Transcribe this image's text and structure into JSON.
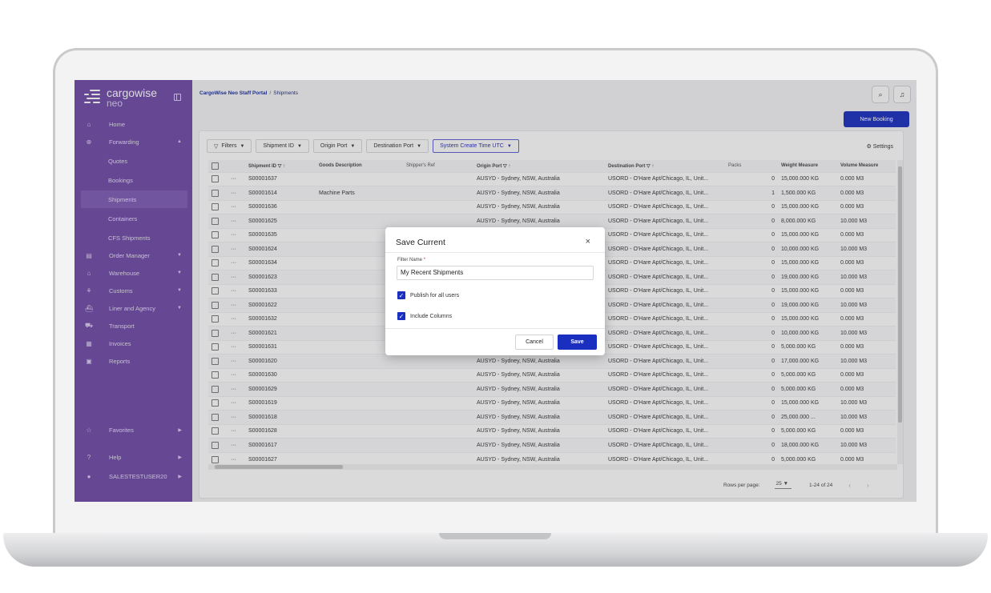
{
  "app": {
    "logo_line1": "cargowise",
    "logo_line2": "neo"
  },
  "breadcrumb": {
    "root": "CargoWise Neo Staff Portal",
    "separator": "/",
    "current": "Shipments"
  },
  "sidebar": {
    "items": [
      {
        "label": "Home",
        "icon": "home-icon",
        "icon_glyph": "⌂"
      },
      {
        "label": "Forwarding",
        "icon": "globe-icon",
        "icon_glyph": "⊕",
        "chevron": "▲"
      },
      {
        "label": "Quotes"
      },
      {
        "label": "Bookings"
      },
      {
        "label": "Shipments"
      },
      {
        "label": "Containers"
      },
      {
        "label": "CFS Shipments"
      },
      {
        "label": "Order Manager",
        "icon": "calendar-icon",
        "icon_glyph": "▤",
        "chevron": "▼"
      },
      {
        "label": "Warehouse",
        "icon": "warehouse-icon",
        "icon_glyph": "⌂",
        "chevron": "▼"
      },
      {
        "label": "Customs",
        "icon": "customs-icon",
        "icon_glyph": "⚘",
        "chevron": "▼"
      },
      {
        "label": "Liner and Agency",
        "icon": "ship-icon",
        "icon_glyph": "⛴",
        "chevron": "▼"
      },
      {
        "label": "Transport",
        "icon": "truck-icon",
        "icon_glyph": "⛟"
      },
      {
        "label": "Invoices",
        "icon": "invoice-icon",
        "icon_glyph": "▦"
      },
      {
        "label": "Reports",
        "icon": "reports-icon",
        "icon_glyph": "▣"
      }
    ],
    "bottom": [
      {
        "label": "Favorites",
        "icon": "star-icon",
        "icon_glyph": "☆",
        "chevron": "▶"
      },
      {
        "label": "Help",
        "icon": "help-icon",
        "icon_glyph": "?",
        "chevron": "▶"
      },
      {
        "label": "SALESTESTUSER20",
        "icon": "user-icon",
        "icon_glyph": "●",
        "chevron": "▶"
      }
    ]
  },
  "header": {
    "search_icon_glyph": "⌕",
    "bell_icon_glyph": "♫",
    "new_booking_label": "New Booking"
  },
  "filters": {
    "filters_label": "Filters",
    "chips": [
      "Shipment ID",
      "Origin Port",
      "Destination Port",
      "System Create Time UTC"
    ],
    "settings_label": "Settings"
  },
  "table": {
    "columns": [
      "Shipment ID",
      "Goods Description",
      "Shipper's Ref",
      "Origin Port",
      "Destination Port",
      "Packs",
      "Weight Measure",
      "Volume Measure"
    ],
    "row_marker": "···",
    "rows": [
      {
        "id": "S00001637",
        "goods": "",
        "ref": "",
        "origin": "AUSYD - Sydney, NSW, Australia",
        "dest": "USORD - O'Hare Apt/Chicago, IL, Unit...",
        "packs": "0",
        "weight": "15,000.000 KG",
        "volume": "0.000 M3"
      },
      {
        "id": "S00001614",
        "goods": "Machine Parts",
        "ref": "",
        "origin": "AUSYD - Sydney, NSW, Australia",
        "dest": "USORD - O'Hare Apt/Chicago, IL, Unit...",
        "packs": "1",
        "weight": "1,500.000 KG",
        "volume": "0.000 M3"
      },
      {
        "id": "S00001636",
        "goods": "",
        "ref": "",
        "origin": "AUSYD - Sydney, NSW, Australia",
        "dest": "USORD - O'Hare Apt/Chicago, IL, Unit...",
        "packs": "0",
        "weight": "15,000.000 KG",
        "volume": "0.000 M3"
      },
      {
        "id": "S00001625",
        "goods": "",
        "ref": "",
        "origin": "AUSYD - Sydney, NSW, Australia",
        "dest": "USORD - O'Hare Apt/Chicago, IL, Unit...",
        "packs": "0",
        "weight": "8,000.000 KG",
        "volume": "10.000 M3"
      },
      {
        "id": "S00001635",
        "goods": "",
        "ref": "",
        "origin": "",
        "dest": "USORD - O'Hare Apt/Chicago, IL, Unit...",
        "packs": "0",
        "weight": "15,000.000 KG",
        "volume": "0.000 M3"
      },
      {
        "id": "S00001624",
        "goods": "",
        "ref": "",
        "origin": "",
        "dest": "USORD - O'Hare Apt/Chicago, IL, Unit...",
        "packs": "0",
        "weight": "10,000.000 KG",
        "volume": "10.000 M3"
      },
      {
        "id": "S00001634",
        "goods": "",
        "ref": "",
        "origin": "",
        "dest": "USORD - O'Hare Apt/Chicago, IL, Unit...",
        "packs": "0",
        "weight": "15,000.000 KG",
        "volume": "0.000 M3"
      },
      {
        "id": "S00001623",
        "goods": "",
        "ref": "",
        "origin": "",
        "dest": "USORD - O'Hare Apt/Chicago, IL, Unit...",
        "packs": "0",
        "weight": "19,000.000 KG",
        "volume": "10.000 M3"
      },
      {
        "id": "S00001633",
        "goods": "",
        "ref": "",
        "origin": "",
        "dest": "USORD - O'Hare Apt/Chicago, IL, Unit...",
        "packs": "0",
        "weight": "15,000.000 KG",
        "volume": "0.000 M3"
      },
      {
        "id": "S00001622",
        "goods": "",
        "ref": "",
        "origin": "",
        "dest": "USORD - O'Hare Apt/Chicago, IL, Unit...",
        "packs": "0",
        "weight": "19,000.000 KG",
        "volume": "10.000 M3"
      },
      {
        "id": "S00001632",
        "goods": "",
        "ref": "",
        "origin": "",
        "dest": "USORD - O'Hare Apt/Chicago, IL, Unit...",
        "packs": "0",
        "weight": "15,000.000 KG",
        "volume": "0.000 M3"
      },
      {
        "id": "S00001621",
        "goods": "",
        "ref": "",
        "origin": "",
        "dest": "USORD - O'Hare Apt/Chicago, IL, Unit...",
        "packs": "0",
        "weight": "10,000.000 KG",
        "volume": "10.000 M3"
      },
      {
        "id": "S00001631",
        "goods": "",
        "ref": "",
        "origin": "",
        "dest": "USORD - O'Hare Apt/Chicago, IL, Unit...",
        "packs": "0",
        "weight": "5,000.000 KG",
        "volume": "0.000 M3"
      },
      {
        "id": "S00001620",
        "goods": "",
        "ref": "",
        "origin": "AUSYD - Sydney, NSW, Australia",
        "dest": "USORD - O'Hare Apt/Chicago, IL, Unit...",
        "packs": "0",
        "weight": "17,000.000 KG",
        "volume": "10.000 M3"
      },
      {
        "id": "S00001630",
        "goods": "",
        "ref": "",
        "origin": "AUSYD - Sydney, NSW, Australia",
        "dest": "USORD - O'Hare Apt/Chicago, IL, Unit...",
        "packs": "0",
        "weight": "5,000.000 KG",
        "volume": "0.000 M3"
      },
      {
        "id": "S00001629",
        "goods": "",
        "ref": "",
        "origin": "AUSYD - Sydney, NSW, Australia",
        "dest": "USORD - O'Hare Apt/Chicago, IL, Unit...",
        "packs": "0",
        "weight": "5,000.000 KG",
        "volume": "0.000 M3"
      },
      {
        "id": "S00001619",
        "goods": "",
        "ref": "",
        "origin": "AUSYD - Sydney, NSW, Australia",
        "dest": "USORD - O'Hare Apt/Chicago, IL, Unit...",
        "packs": "0",
        "weight": "15,000.000 KG",
        "volume": "10.000 M3"
      },
      {
        "id": "S00001618",
        "goods": "",
        "ref": "",
        "origin": "AUSYD - Sydney, NSW, Australia",
        "dest": "USORD - O'Hare Apt/Chicago, IL, Unit...",
        "packs": "0",
        "weight": "25,000.000 ...",
        "volume": "10.000 M3"
      },
      {
        "id": "S00001628",
        "goods": "",
        "ref": "",
        "origin": "AUSYD - Sydney, NSW, Australia",
        "dest": "USORD - O'Hare Apt/Chicago, IL, Unit...",
        "packs": "0",
        "weight": "5,000.000 KG",
        "volume": "0.000 M3"
      },
      {
        "id": "S00001617",
        "goods": "",
        "ref": "",
        "origin": "AUSYD - Sydney, NSW, Australia",
        "dest": "USORD - O'Hare Apt/Chicago, IL, Unit...",
        "packs": "0",
        "weight": "18,000.000 KG",
        "volume": "10.000 M3"
      },
      {
        "id": "S00001627",
        "goods": "",
        "ref": "",
        "origin": "AUSYD - Sydney, NSW, Australia",
        "dest": "USORD - O'Hare Apt/Chicago, IL, Unit...",
        "packs": "0",
        "weight": "5,000.000 KG",
        "volume": "0.000 M3"
      }
    ]
  },
  "pagination": {
    "rows_per_page_label": "Rows per page:",
    "rows_per_page_value": "25",
    "range_label": "1-24 of 24",
    "prev_glyph": "‹",
    "next_glyph": "›"
  },
  "modal": {
    "title": "Save Current",
    "close_glyph": "×",
    "field_label": "Filter Name",
    "required_mark": "*",
    "field_value": "My Recent Shipments",
    "check1_label": "Publish for all users",
    "check1_checked": true,
    "check2_label": "Include Columns",
    "check2_checked": true,
    "check_glyph": "✓",
    "cancel_label": "Cancel",
    "save_label": "Save"
  },
  "colors": {
    "sidebar": "#6e4aa6",
    "accent": "#1a2fbf"
  }
}
